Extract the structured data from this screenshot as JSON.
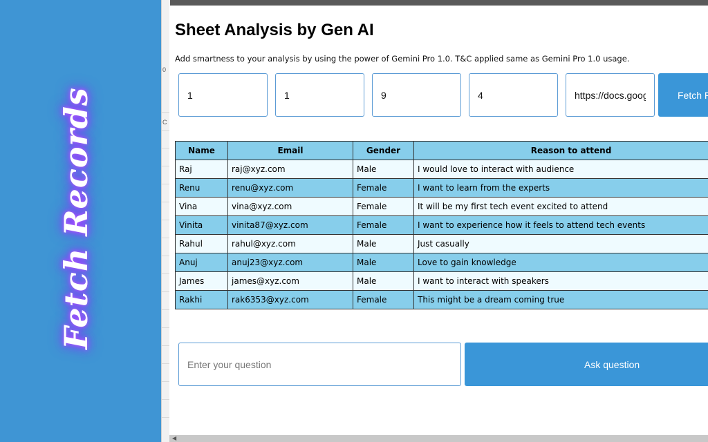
{
  "sidebar": {
    "vertical_title": "Fetch Records"
  },
  "dialog": {
    "title": "Sheet Analysis by Gen AI",
    "subtitle": "Add smartness to your analysis by using the power of Gemini Pro 1.0. T&C applied same as Gemini Pro 1.0 usage.",
    "inputs": [
      "1",
      "1",
      "9",
      "4",
      "https://docs.google.com/spreadsheets"
    ],
    "fetch_button": "Fetch Records"
  },
  "table": {
    "headers": [
      "Name",
      "Email",
      "Gender",
      "Reason to attend"
    ],
    "rows": [
      [
        "Raj",
        "raj@xyz.com",
        "Male",
        "I would love to interact with audience"
      ],
      [
        "Renu",
        "renu@xyz.com",
        "Female",
        "I want to learn from the experts"
      ],
      [
        "Vina",
        "vina@xyz.com",
        "Female",
        "It will be my first tech event excited to attend"
      ],
      [
        "Vinita",
        "vinita87@xyz.com",
        "Female",
        "I want to experience how it feels to attend tech events"
      ],
      [
        "Rahul",
        "rahul@xyz.com",
        "Male",
        "Just casually"
      ],
      [
        "Anuj",
        "anuj23@xyz.com",
        "Male",
        "Love to gain knowledge"
      ],
      [
        "James",
        "james@xyz.com",
        "Male",
        "I want to interact with speakers"
      ],
      [
        "Rakhi",
        "rak6353@xyz.com",
        "Female",
        "This might be a dream coming true"
      ]
    ]
  },
  "question": {
    "placeholder": "Enter your question",
    "ask_button": "Ask question"
  },
  "background_sheet": {
    "glyphs": [
      "0",
      "C"
    ]
  },
  "colors": {
    "left_panel": "#3f95d4",
    "button": "#3a96d8",
    "header_row": "#87ceeb",
    "alt_row": "#87ceeb",
    "row": "#effbff",
    "title_glow": "#9b3dff"
  }
}
